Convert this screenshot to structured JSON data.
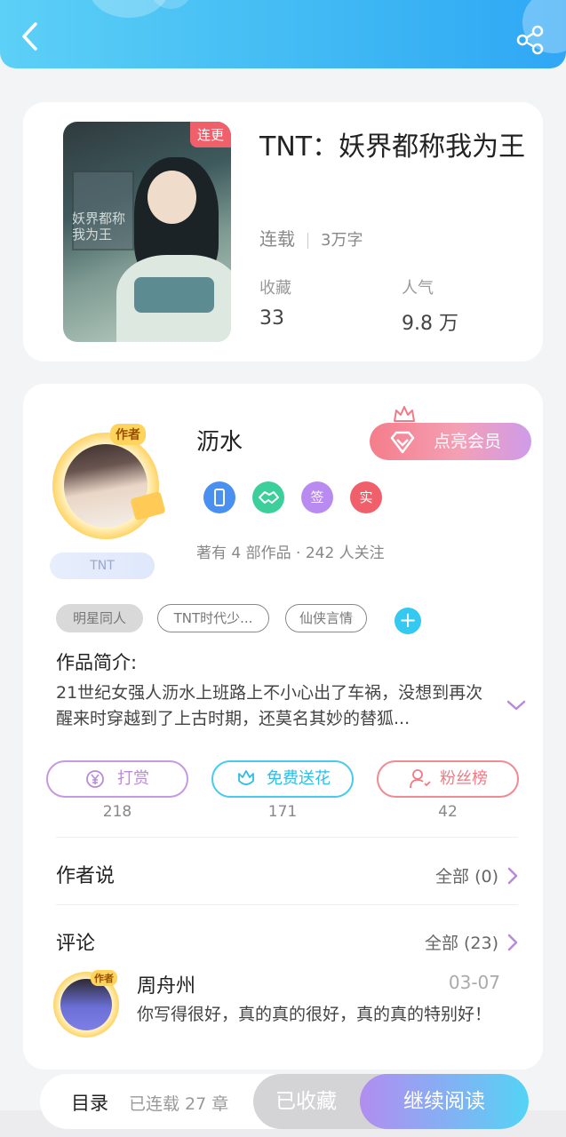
{
  "book": {
    "cover_tag": "连更",
    "cover_text": "妖界都称我为王",
    "title": "TNT：妖界都称我为王",
    "status": "连载",
    "words": "3万字",
    "stats": [
      {
        "label": "收藏",
        "value": "33"
      },
      {
        "label": "人气",
        "value": "9.8 万"
      }
    ]
  },
  "author": {
    "badge": "作者",
    "name": "沥水",
    "fan_tag": "TNT",
    "vip_label": "点亮会员",
    "badges": [
      {
        "icon": "phone-badge-icon",
        "label": "",
        "color": "#4a90f0"
      },
      {
        "icon": "handshake-badge-icon",
        "label": "",
        "color": "#3ccf9c"
      },
      {
        "icon": "sign-badge-icon",
        "label": "签",
        "color": "#b98af0"
      },
      {
        "icon": "real-badge-icon",
        "label": "实",
        "color": "#f0606b"
      }
    ],
    "summary": "著有 4 部作品 · 242 人关注"
  },
  "tags": [
    "明星同人",
    "TNT时代少...",
    "仙侠言情"
  ],
  "intro": {
    "title": "作品简介:",
    "text": "21世纪女强人沥水上班路上不小心出了车祸，没想到再次醒来时穿越到了上古时期，还莫名其妙的替狐..."
  },
  "actions": [
    {
      "label": "打赏",
      "count": "218",
      "icon": "yen-coin-icon",
      "color": "#b98ad8"
    },
    {
      "label": "免费送花",
      "count": "171",
      "icon": "flower-icon",
      "color": "#39c6ea"
    },
    {
      "label": "粉丝榜",
      "count": "42",
      "icon": "fan-user-icon",
      "color": "#ef7b84"
    }
  ],
  "author_says": {
    "title": "作者说",
    "more": "全部 (0)"
  },
  "comments": {
    "title": "评论",
    "more": "全部 (23)",
    "items": [
      {
        "badge": "作者",
        "name": "周舟州",
        "date": "03-07",
        "text": "你写得很好，真的真的很好，真的真的特别好！"
      }
    ]
  },
  "bottom": {
    "toc": "目录",
    "chapters": "已连载 27 章",
    "collected": "已收藏",
    "read": "继续阅读"
  },
  "colors": {
    "header_start": "#5cd0f6",
    "header_end": "#2fa7f5",
    "accent_red": "#f0606b"
  }
}
